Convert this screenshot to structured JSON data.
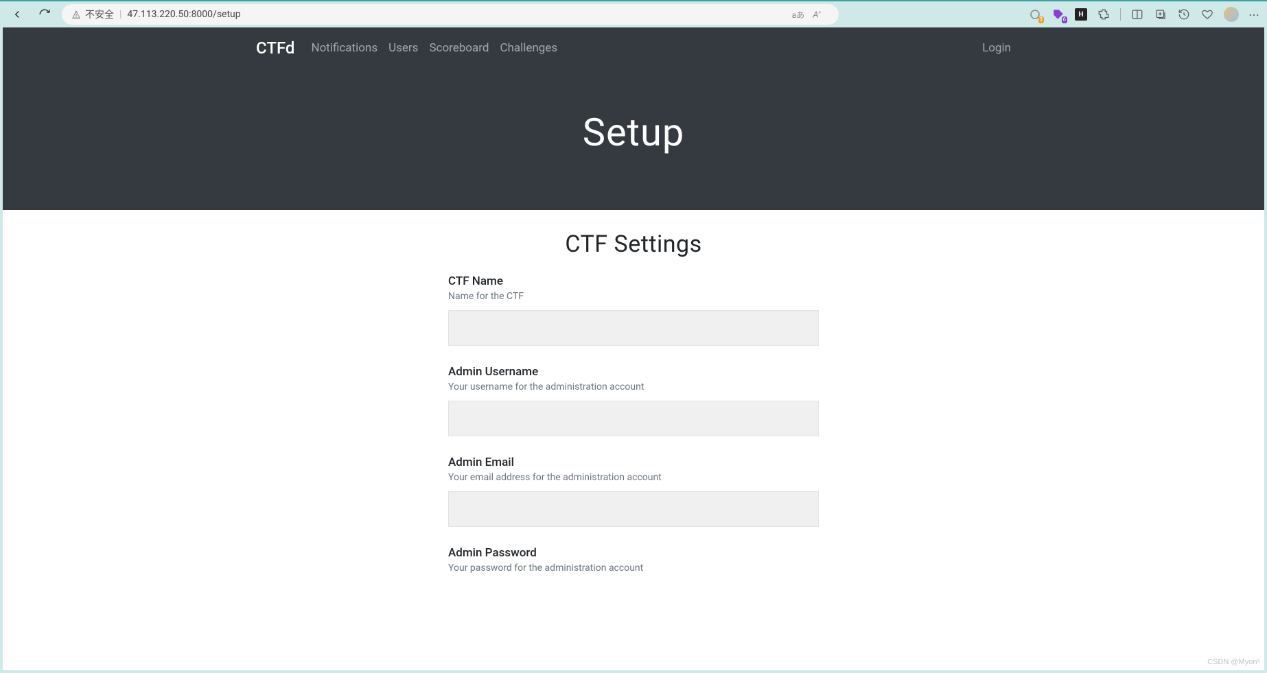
{
  "browser": {
    "insecure_label": "不安全",
    "url": "47.113.220.50:8000/setup",
    "ext_badge_orange": "3",
    "ext_badge_purple": "6",
    "ext_letter": "H"
  },
  "navbar": {
    "brand": "CTFd",
    "links": [
      "Notifications",
      "Users",
      "Scoreboard",
      "Challenges"
    ],
    "right": {
      "login": "Login"
    }
  },
  "jumbotron": {
    "title": "Setup"
  },
  "form": {
    "section_title": "CTF Settings",
    "fields": [
      {
        "label": "CTF Name",
        "help": "Name for the CTF",
        "value": ""
      },
      {
        "label": "Admin Username",
        "help": "Your username for the administration account",
        "value": ""
      },
      {
        "label": "Admin Email",
        "help": "Your email address for the administration account",
        "value": ""
      },
      {
        "label": "Admin Password",
        "help": "Your password for the administration account",
        "value": ""
      }
    ]
  },
  "watermark": "CSDN @Myon⁵"
}
